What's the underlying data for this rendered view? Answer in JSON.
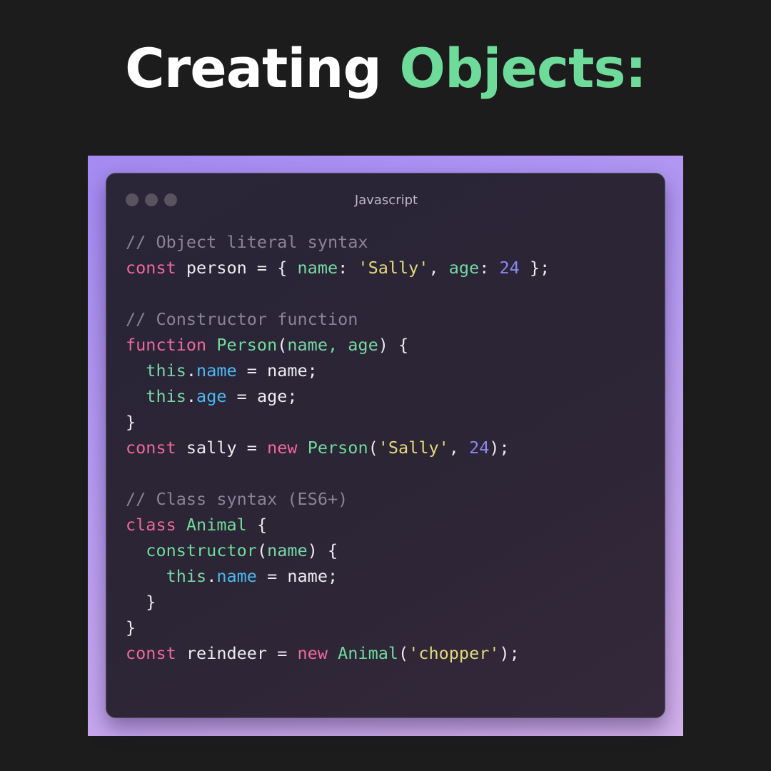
{
  "title": {
    "word1": "Creating",
    "word2": "Objects:"
  },
  "window": {
    "language": "Javascript"
  },
  "code": {
    "lines": [
      [
        {
          "t": "// Object literal syntax",
          "k": "com"
        }
      ],
      [
        {
          "t": "const",
          "k": "kw"
        },
        {
          "t": " person = { ",
          "k": "txt"
        },
        {
          "t": "name",
          "k": "key"
        },
        {
          "t": ": ",
          "k": "txt"
        },
        {
          "t": "'Sally'",
          "k": "str"
        },
        {
          "t": ", ",
          "k": "txt"
        },
        {
          "t": "age",
          "k": "key"
        },
        {
          "t": ": ",
          "k": "txt"
        },
        {
          "t": "24",
          "k": "num"
        },
        {
          "t": " };",
          "k": "txt"
        }
      ],
      [],
      [
        {
          "t": "// Constructor function",
          "k": "com"
        }
      ],
      [
        {
          "t": "function",
          "k": "kw"
        },
        {
          "t": " ",
          "k": "txt"
        },
        {
          "t": "Person",
          "k": "fn"
        },
        {
          "t": "(",
          "k": "txt"
        },
        {
          "t": "name, age",
          "k": "key"
        },
        {
          "t": ") {",
          "k": "txt"
        }
      ],
      [
        {
          "t": "  ",
          "k": "txt"
        },
        {
          "t": "this",
          "k": "this"
        },
        {
          "t": ".",
          "k": "txt"
        },
        {
          "t": "name",
          "k": "prop"
        },
        {
          "t": " = name;",
          "k": "txt"
        }
      ],
      [
        {
          "t": "  ",
          "k": "txt"
        },
        {
          "t": "this",
          "k": "this"
        },
        {
          "t": ".",
          "k": "txt"
        },
        {
          "t": "age",
          "k": "prop"
        },
        {
          "t": " = age;",
          "k": "txt"
        }
      ],
      [
        {
          "t": "}",
          "k": "txt"
        }
      ],
      [
        {
          "t": "const",
          "k": "kw"
        },
        {
          "t": " sally = ",
          "k": "txt"
        },
        {
          "t": "new",
          "k": "kw"
        },
        {
          "t": " ",
          "k": "txt"
        },
        {
          "t": "Person",
          "k": "fn"
        },
        {
          "t": "(",
          "k": "txt"
        },
        {
          "t": "'Sally'",
          "k": "str"
        },
        {
          "t": ", ",
          "k": "txt"
        },
        {
          "t": "24",
          "k": "num"
        },
        {
          "t": ");",
          "k": "txt"
        }
      ],
      [],
      [
        {
          "t": "// Class syntax (ES6+)",
          "k": "com"
        }
      ],
      [
        {
          "t": "class",
          "k": "kw"
        },
        {
          "t": " ",
          "k": "txt"
        },
        {
          "t": "Animal",
          "k": "fn"
        },
        {
          "t": " {",
          "k": "txt"
        }
      ],
      [
        {
          "t": "  ",
          "k": "txt"
        },
        {
          "t": "constructor",
          "k": "fn"
        },
        {
          "t": "(",
          "k": "txt"
        },
        {
          "t": "name",
          "k": "key"
        },
        {
          "t": ") {",
          "k": "txt"
        }
      ],
      [
        {
          "t": "    ",
          "k": "txt"
        },
        {
          "t": "this",
          "k": "this"
        },
        {
          "t": ".",
          "k": "txt"
        },
        {
          "t": "name",
          "k": "prop"
        },
        {
          "t": " = name;",
          "k": "txt"
        }
      ],
      [
        {
          "t": "  }",
          "k": "txt"
        }
      ],
      [
        {
          "t": "}",
          "k": "txt"
        }
      ],
      [
        {
          "t": "const",
          "k": "kw"
        },
        {
          "t": " reindeer = ",
          "k": "txt"
        },
        {
          "t": "new",
          "k": "kw"
        },
        {
          "t": " ",
          "k": "txt"
        },
        {
          "t": "Animal",
          "k": "fn"
        },
        {
          "t": "(",
          "k": "txt"
        },
        {
          "t": "'chopper'",
          "k": "str"
        },
        {
          "t": ");",
          "k": "txt"
        }
      ]
    ]
  },
  "colors": {
    "background": "#1c1c1c",
    "title_white": "#ffffff",
    "title_accent": "#6fdb9a",
    "frame_gradient_start": "#a48af2",
    "frame_gradient_end": "#d4b2ea",
    "window_bg": "#2a2537",
    "comment": "#8a8396",
    "keyword": "#f0679d",
    "function": "#6fdb9a",
    "string": "#e3d97a",
    "number": "#8c87ef",
    "property": "#4cb8f0"
  }
}
